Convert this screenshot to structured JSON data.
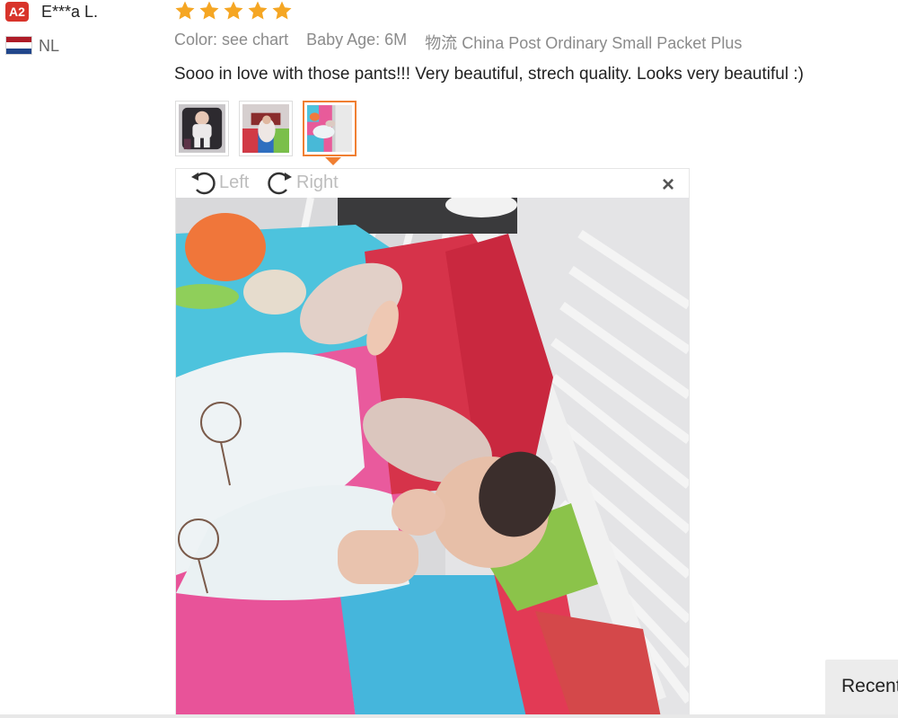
{
  "reviewer": {
    "badge": "A2",
    "name": "E***a L.",
    "country": "NL",
    "flag_colors": [
      "#ae1c28",
      "#ffffff",
      "#21468b"
    ]
  },
  "rating": {
    "stars": 5,
    "star_color": "#f5a623",
    "icon": "star-icon"
  },
  "meta": {
    "color_label": "Color:",
    "color_value": "see chart",
    "age_label": "Baby Age:",
    "age_value": "6M",
    "shipping_label": "物流",
    "shipping_value": "China Post Ordinary Small Packet Plus"
  },
  "review_text": "Sooo in love with those pants!!! Very beautiful, strech quality. Looks very beautiful :)",
  "thumbnails": [
    {
      "alt": "review photo 1",
      "active": false
    },
    {
      "alt": "review photo 2",
      "active": false
    },
    {
      "alt": "review photo 3",
      "active": true
    }
  ],
  "viewer": {
    "rotate_left": "Left",
    "rotate_right": "Right",
    "close": "×"
  },
  "recent_tab": "Recent",
  "colors": {
    "accent": "#f07f32",
    "badge": "#d8342b"
  }
}
